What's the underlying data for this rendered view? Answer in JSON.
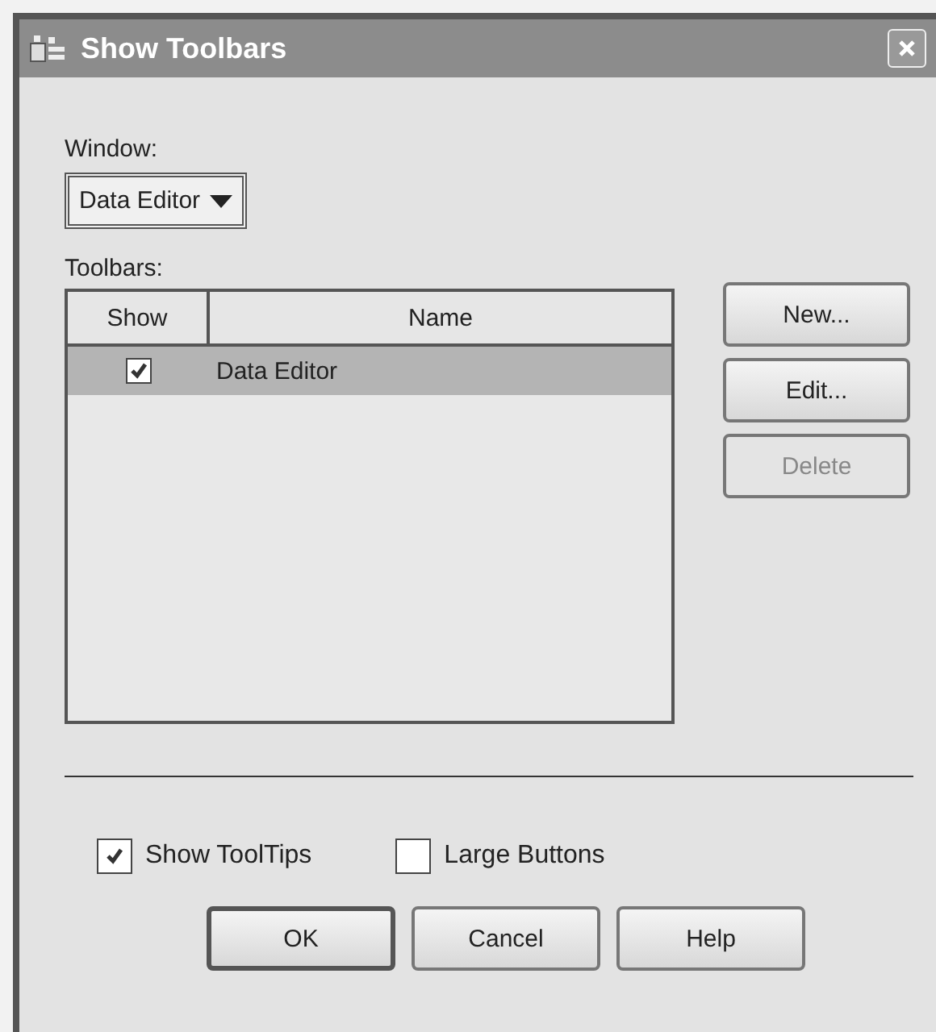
{
  "window": {
    "title": "Show Toolbars"
  },
  "window_select": {
    "label": "Window:",
    "value": "Data Editor"
  },
  "toolbars": {
    "label": "Toolbars:",
    "columns": [
      "Show",
      "Name"
    ],
    "rows": [
      {
        "show": true,
        "name": "Data Editor",
        "selected": true
      }
    ]
  },
  "side_buttons": [
    {
      "label": "New...",
      "disabled": false
    },
    {
      "label": "Edit...",
      "disabled": false
    },
    {
      "label": "Delete",
      "disabled": true
    }
  ],
  "options": [
    {
      "label": "Show ToolTips",
      "checked": true
    },
    {
      "label": "Large Buttons",
      "checked": false
    }
  ],
  "buttons": [
    {
      "label": "OK",
      "default": true
    },
    {
      "label": "Cancel",
      "default": false
    },
    {
      "label": "Help",
      "default": false
    }
  ]
}
